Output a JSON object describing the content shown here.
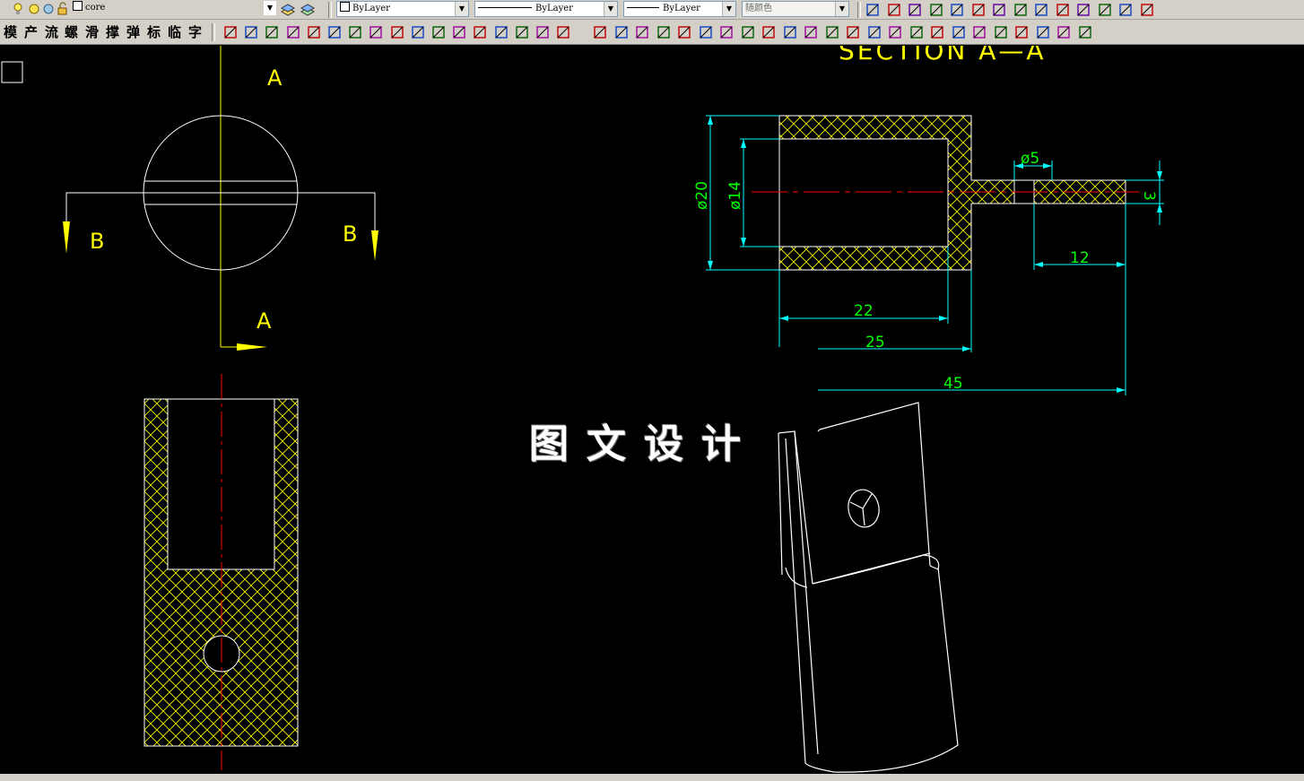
{
  "toolbar_props": {
    "layer": "core",
    "color": "ByLayer",
    "linetype": "ByLayer",
    "lineweight": "ByLayer",
    "plotstyle": "随颜色"
  },
  "menu_labels": [
    "模",
    "产",
    "流",
    "螺",
    "滑",
    "撑",
    "弹",
    "标",
    "临",
    "字"
  ],
  "icon_names": [
    "layer-icon",
    "dimension-icon",
    "hatch-icon",
    "snap-icon"
  ],
  "colors": {
    "canvas": "#000000",
    "object": "#ffffff",
    "centerline": "#ff0000",
    "hatch": "#ffff00",
    "dimension": "#00ffff",
    "dim_text": "#00ff00",
    "label": "#ffff00"
  },
  "drawing": {
    "section_title": "SECTION  A—A",
    "view_labels": {
      "a_top": "A",
      "a_bottom": "A",
      "b_left": "B",
      "b_right": "B"
    },
    "dimensions": {
      "d20": "ø20",
      "d14": "ø14",
      "d5": "ø5",
      "d3": "3",
      "d12": "12",
      "d22": "22",
      "d25": "25",
      "d45": "45"
    }
  },
  "watermark": "图文设计"
}
